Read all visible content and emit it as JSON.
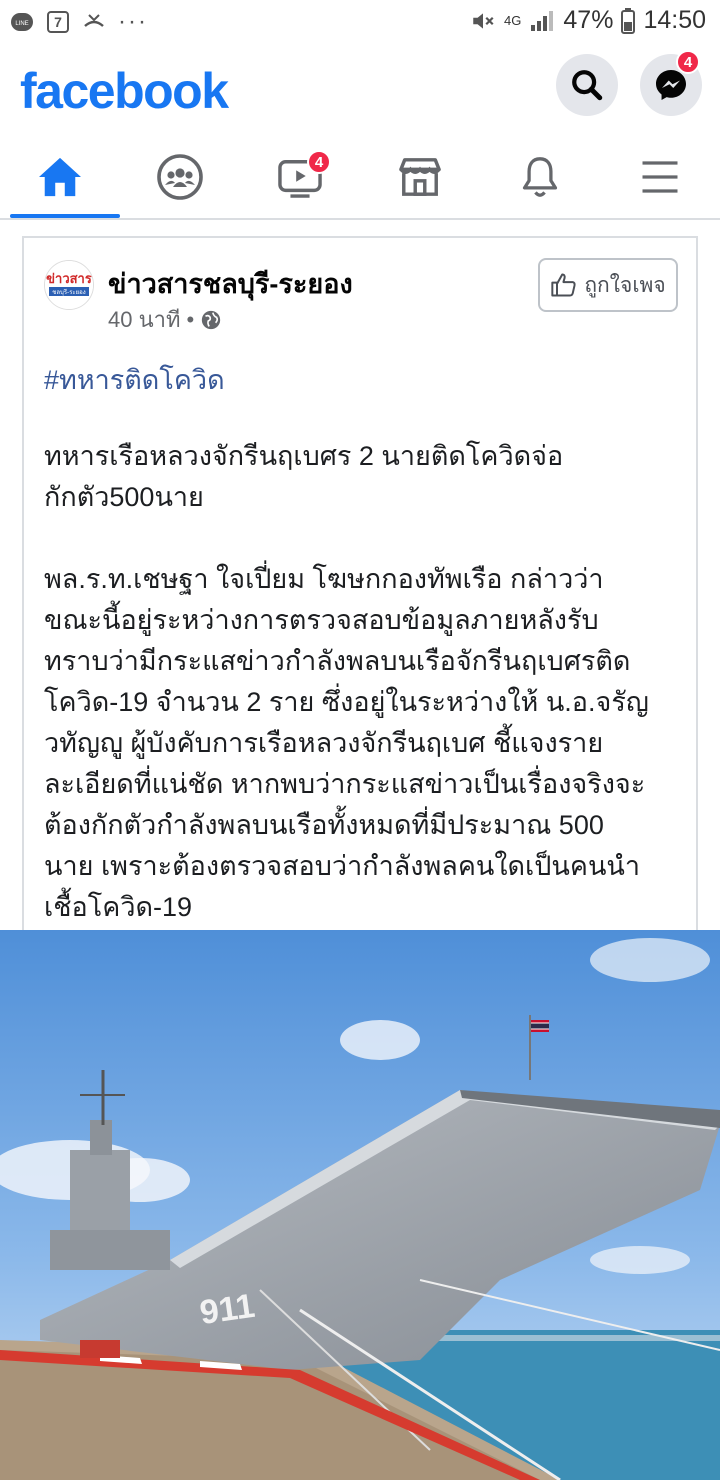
{
  "status_bar": {
    "battery": "47%",
    "time": "14:50",
    "network": "4G",
    "line_label": "LINE",
    "dots": "···"
  },
  "header": {
    "logo": "facebook",
    "messenger_badge": "4"
  },
  "nav": {
    "tabs": [
      {
        "name": "home",
        "active": true
      },
      {
        "name": "groups"
      },
      {
        "name": "watch",
        "badge": "4"
      },
      {
        "name": "marketplace"
      },
      {
        "name": "notifications"
      },
      {
        "name": "menu"
      }
    ]
  },
  "post": {
    "page_name": "ข่าวสารชลบุรี-ระยอง",
    "time": "40 นาที",
    "avatar_text_top": "ข่าวสาร",
    "avatar_text_bottom": "ชลบุรี-ระยอง",
    "like_page_label": "ถูกใจเพจ",
    "hashtag": "#ทหารติดโควิด",
    "headline": "ทหารเรือหลวงจักรีนฤเบศร 2 นายติดโควิดจ่อ\nกักตัว500นาย",
    "body": "พล.ร.ท.เชษฐา ใจเปี่ยม โฆษกกองทัพเรือ กล่าวว่า\nขณะนี้อยู่ระหว่างการตรวจสอบข้อมูลภายหลังรับ\nทราบว่ามีกระแสข่าวกำลังพลบนเรือจักรีนฤเบศรติด\nโควิด-19 จำนวน 2 ราย ซึ่งอยู่ในระหว่างให้ น.อ.จรัญ\nวทัญญู ผู้บังคับการเรือหลวงจักรีนฤเบศ ชี้แจงราย\nละเอียดที่แน่ชัด หากพบว่ากระแสข่าวเป็นเรื่องจริงจะ\nต้องกักตัวกำลังพลบนเรือทั้งหมดที่มีประมาณ 500\nนาย เพราะต้องตรวจสอบว่ากำลังพลคนใดเป็นคนนำ\nเชื้อโควิด-19",
    "image_hull_number": "911"
  },
  "colors": {
    "brand": "#1877f2",
    "badge": "#f02849",
    "hashtag": "#385898"
  }
}
